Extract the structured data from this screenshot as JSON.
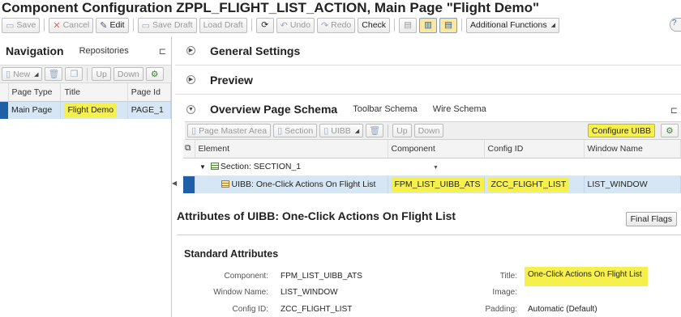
{
  "window": {
    "title": "Component Configuration ZPPL_FLIGHT_LIST_ACTION, Main Page \"Flight Demo\""
  },
  "toolbar": {
    "save": "Save",
    "cancel": "Cancel",
    "edit": "Edit",
    "save_draft": "Save Draft",
    "load_draft": "Load Draft",
    "undo": "Undo",
    "redo": "Redo",
    "check": "Check",
    "additional": "Additional Functions"
  },
  "navigation": {
    "title": "Navigation",
    "tab_repositories": "Repositories",
    "tools": {
      "new": "New",
      "up": "Up",
      "down": "Down"
    },
    "columns": [
      "Page Type",
      "Title",
      "Page Id"
    ],
    "rows": [
      {
        "type": "Main Page",
        "title": "Flight Demo",
        "id": "PAGE_1"
      }
    ]
  },
  "sections": {
    "general": "General Settings",
    "preview": "Preview",
    "overview": "Overview Page Schema",
    "toolbar_schema": "Toolbar Schema",
    "wire_schema": "Wire Schema"
  },
  "schema_tools": {
    "page_master": "Page Master Area",
    "section": "Section",
    "uibb": "UIBB",
    "up": "Up",
    "down": "Down",
    "configure": "Configure UIBB"
  },
  "grid": {
    "columns": [
      "Element",
      "Component",
      "Config ID",
      "Window Name"
    ],
    "section_row": "Section: SECTION_1",
    "uibb_row": {
      "element": "UIBB: One-Click Actions  On Flight List",
      "component": "FPM_LIST_UIBB_ATS",
      "config": "ZCC_FLIGHT_LIST",
      "window": "LIST_WINDOW"
    }
  },
  "attributes": {
    "title": "Attributes of UIBB: One-Click Actions On Flight List",
    "final_flags": "Final Flags",
    "std_title": "Standard Attributes",
    "component_label": "Component:",
    "component_value": "FPM_LIST_UIBB_ATS",
    "window_label": "Window Name:",
    "window_value": "LIST_WINDOW",
    "config_label": "Config ID:",
    "config_value": "ZCC_FLIGHT_LIST",
    "title_label": "Title:",
    "title_value": "One-Click Actions  On Flight List",
    "image_label": "Image:",
    "padding_label": "Padding:",
    "padding_value": "Automatic (Default)"
  },
  "colors": {
    "highlight": "#f6f04d",
    "selection": "#d7e6f4",
    "marker": "#1e5fa8"
  }
}
